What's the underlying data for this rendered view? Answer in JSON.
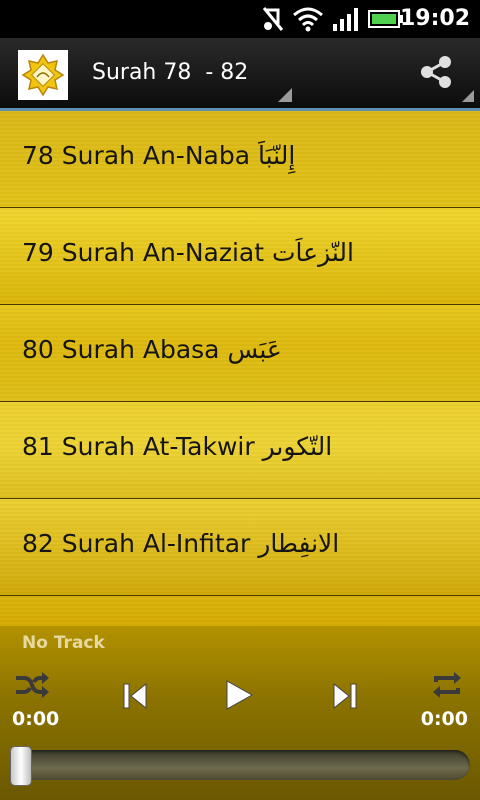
{
  "status_bar": {
    "time": "19:02",
    "icons": [
      "headset-muted-icon",
      "wifi-icon",
      "signal-icon",
      "battery-icon"
    ]
  },
  "action_bar": {
    "title": "Surah 78  - 82",
    "share_icon": "share-icon",
    "logo_icon": "quran-logo-icon"
  },
  "surah_list": [
    {
      "label": "78 Surah An-Naba إِلنّبَاَ"
    },
    {
      "label": "79 Surah An-Naziat النّزعاَت"
    },
    {
      "label": "80 Surah Abasa عَبَس"
    },
    {
      "label": "81 Surah At-Takwir التّکوىر"
    },
    {
      "label": "82 Surah Al-Infitar الانفِطار"
    }
  ],
  "player": {
    "track": "No Track",
    "current_time": "0:00",
    "total_time": "0:00",
    "progress": 0,
    "controls": [
      "shuffle-icon",
      "previous-icon",
      "play-icon",
      "next-icon",
      "repeat-icon"
    ]
  },
  "colors": {
    "list_gold": "#e8c30f",
    "actionbar_border": "#5f8fb3",
    "player_bg": "#8d7400"
  }
}
